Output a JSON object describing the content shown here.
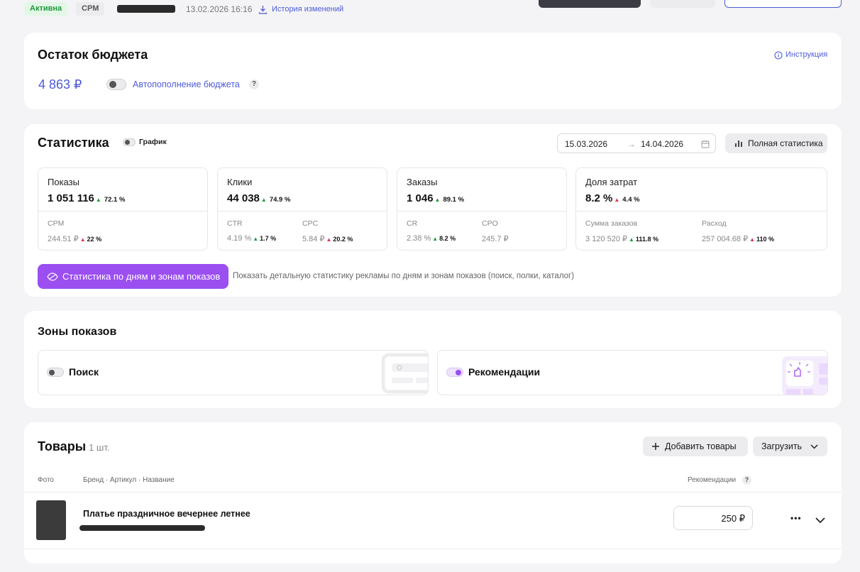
{
  "topbar": {
    "status": "Активна",
    "type": "CPM",
    "datetime": "13.02.2026 16:16",
    "history_link": "История изменений"
  },
  "budget": {
    "title": "Остаток бюджета",
    "amount": "4 863 ₽",
    "autofill_label": "Автопополнение бюджета",
    "help": "?",
    "instruction_link": "Инструкция"
  },
  "stats": {
    "title": "Статистика",
    "chart_toggle_label": "График",
    "date_from": "15.03.2026",
    "date_arrow": "→",
    "date_to": "14.04.2026",
    "full_stats_button": "Полная статистика",
    "metrics": [
      {
        "label": "Показы",
        "value": "1 051 116",
        "change": "72.1 %",
        "sub": [
          {
            "label": "CPM",
            "value": "244.51 ₽",
            "change": "22 %"
          }
        ]
      },
      {
        "label": "Клики",
        "value": "44 038",
        "change": "74.9 %",
        "sub": [
          {
            "label": "CTR",
            "value": "4.19 %",
            "change": "1.7 %"
          },
          {
            "label": "CPC",
            "value": "5.84 ₽",
            "change": "20.2 %"
          }
        ]
      },
      {
        "label": "Заказы",
        "value": "1 046",
        "change": "89.1 %",
        "sub": [
          {
            "label": "CR",
            "value": "2.38 %",
            "change": "8.2 %"
          },
          {
            "label": "CPO",
            "value": "245.7 ₽",
            "change": ""
          }
        ]
      },
      {
        "label": "Доля затрат",
        "value": "8.2 %",
        "change": "4.4 %",
        "sub": [
          {
            "label": "Сумма заказов",
            "value": "3 120 520 ₽",
            "change": "111.8 %"
          },
          {
            "label": "Расход",
            "value": "257 004.68 ₽",
            "change": "110 %"
          }
        ]
      }
    ],
    "cta_button": "Статистика по дням и зонам показов",
    "cta_hint": "Показать детальную статистику рекламы по дням и зонам показов (поиск, полки, каталог)"
  },
  "zones": {
    "title": "Зоны показов",
    "items": [
      {
        "label": "Поиск",
        "enabled": false
      },
      {
        "label": "Рекомендации",
        "enabled": true
      }
    ]
  },
  "products": {
    "title": "Товары",
    "count": "1 шт.",
    "add_button": "Добавить товары",
    "upload_button": "Загрузить",
    "columns": {
      "photo": "Фото",
      "name": "Бренд · Артикул · Название",
      "recommendations": "Рекомендации"
    },
    "help": "?",
    "rows": [
      {
        "name": "Платье праздничное вечернее летнее",
        "bid": "250 ₽",
        "more": "•••"
      }
    ]
  },
  "colors": {
    "accent": "#9b4ff0",
    "link": "#4e5bd8",
    "up": "#1f9a3c",
    "down": "#e0334a"
  }
}
